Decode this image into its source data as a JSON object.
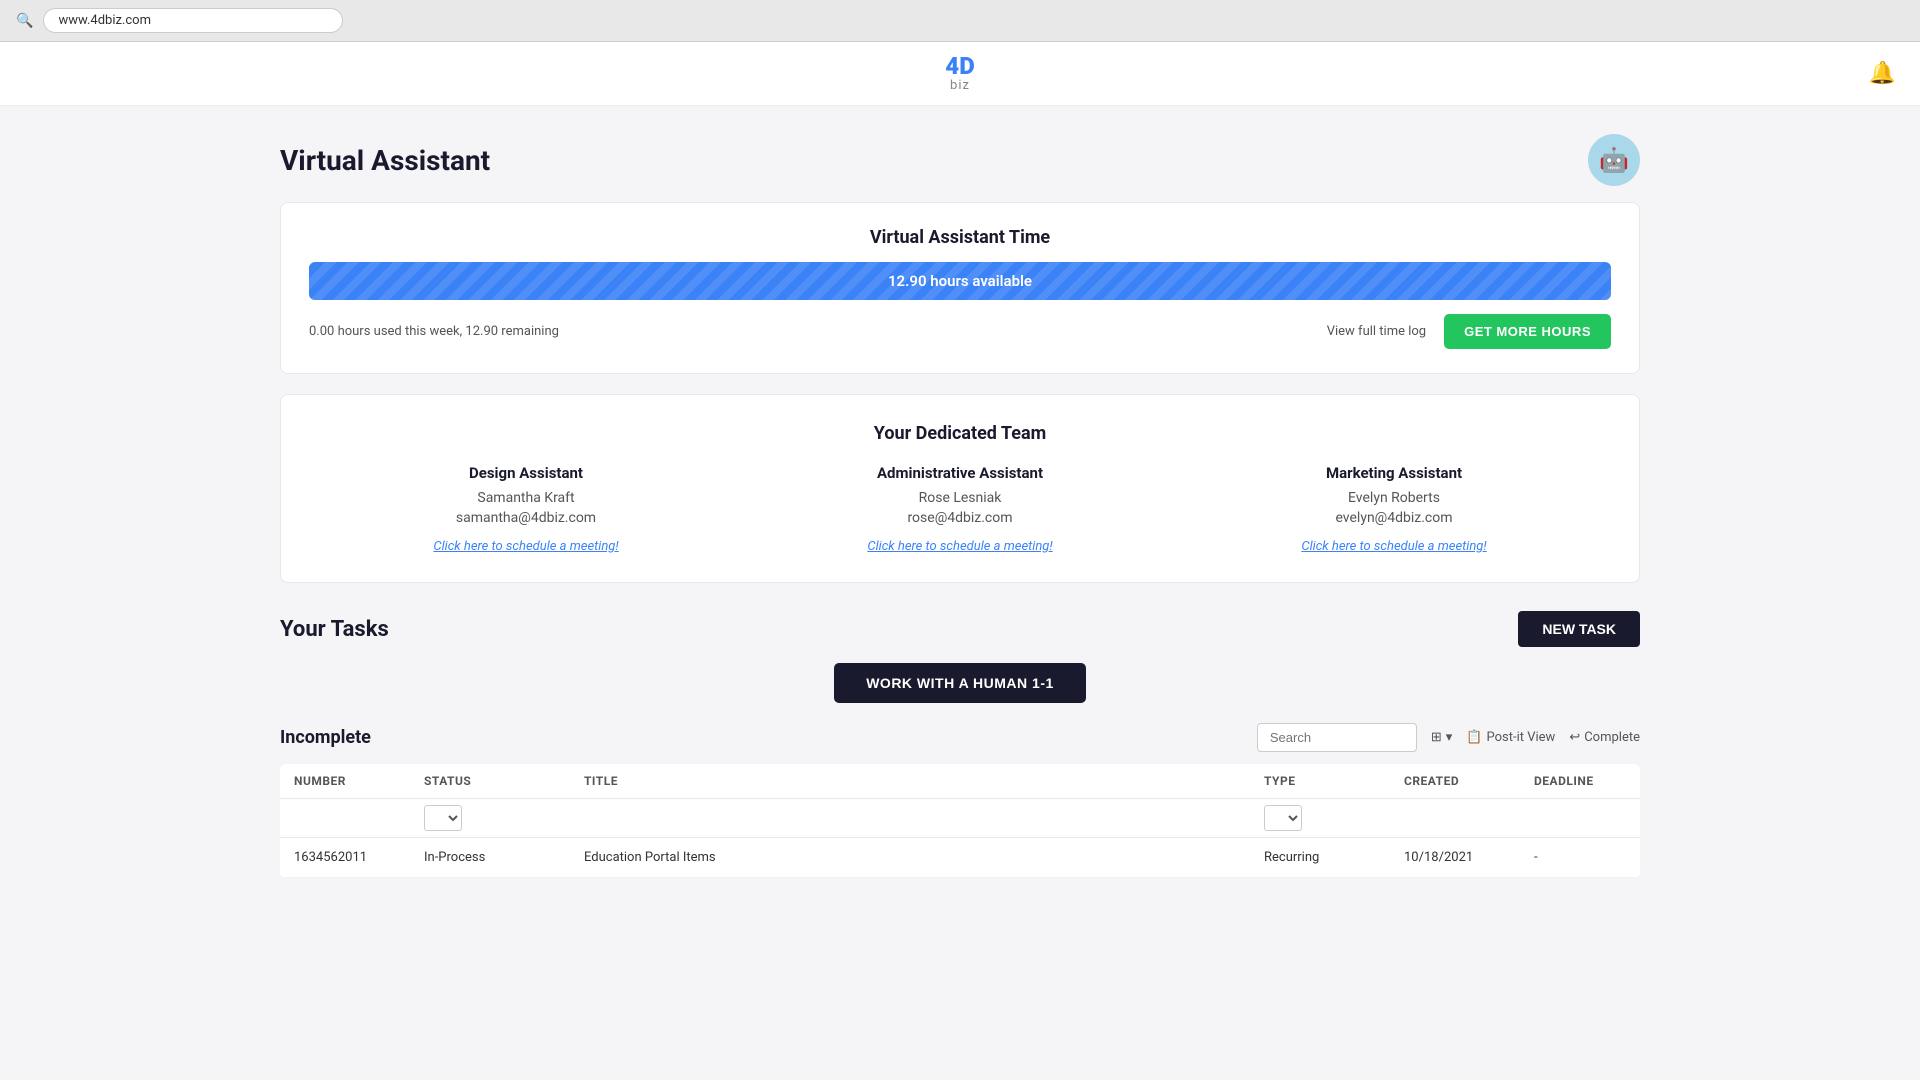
{
  "browser": {
    "url": "www.4dbiz.com"
  },
  "nav": {
    "logo_4d": "4D",
    "logo_biz": "biz"
  },
  "virtual_assistant": {
    "title": "Virtual Assistant",
    "time_section": {
      "heading": "Virtual Assistant Time",
      "progress_text": "12.90 hours available",
      "hours_used_text": "0.00 hours used this week, 12.90 remaining",
      "view_log_label": "View full time log",
      "get_more_label": "GET MORE HOURS"
    },
    "team_section": {
      "heading": "Your Dedicated Team",
      "members": [
        {
          "role": "Design Assistant",
          "name": "Samantha Kraft",
          "email": "samantha@4dbiz.com",
          "schedule_link": "Click here to schedule a meeting!"
        },
        {
          "role": "Administrative Assistant",
          "name": "Rose Lesniak",
          "email": "rose@4dbiz.com",
          "schedule_link": "Click here to schedule a meeting!"
        },
        {
          "role": "Marketing Assistant",
          "name": "Evelyn Roberts",
          "email": "evelyn@4dbiz.com",
          "schedule_link": "Click here to schedule a meeting!"
        }
      ]
    }
  },
  "tasks": {
    "title": "Your Tasks",
    "new_task_label": "NEW TASK",
    "work_human_label": "WORK WITH A HUMAN 1-1",
    "incomplete_title": "Incomplete",
    "search_placeholder": "Search",
    "controls": {
      "view_toggle_icon": "⊞",
      "post_it_label": "Post-it View",
      "complete_label": "Complete"
    },
    "columns": {
      "number": "NUMBER",
      "status": "STATUS",
      "title": "TITLE",
      "type": "TYPE",
      "created": "CREATED",
      "deadline": "DEADLINE"
    },
    "rows": [
      {
        "number": "1634562011",
        "status": "In-Process",
        "title": "Education Portal Items",
        "type": "Recurring",
        "created": "10/18/2021",
        "deadline": "-"
      }
    ]
  }
}
